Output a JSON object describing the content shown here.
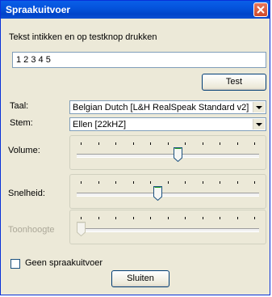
{
  "window": {
    "title": "Spraakuitvoer"
  },
  "test": {
    "instruction": "Tekst intikken en op testknop drukken",
    "input_value": "1 2 3 4 5",
    "button_label": "Test"
  },
  "language": {
    "label": "Taal:",
    "value": "Belgian Dutch [L&H RealSpeak Standard v2]"
  },
  "voice": {
    "label": "Stem:",
    "value": "Ellen [22kHZ]"
  },
  "volume": {
    "label": "Volume:",
    "level": 0.56
  },
  "speed": {
    "label": "Snelheid:",
    "level": 0.44
  },
  "pitch": {
    "label": "Toonhoogte",
    "level": 0.0,
    "disabled": true
  },
  "no_speech": {
    "label": "Geen spraakuitvoer",
    "checked": false
  },
  "close_button": {
    "label": "Sluiten"
  }
}
